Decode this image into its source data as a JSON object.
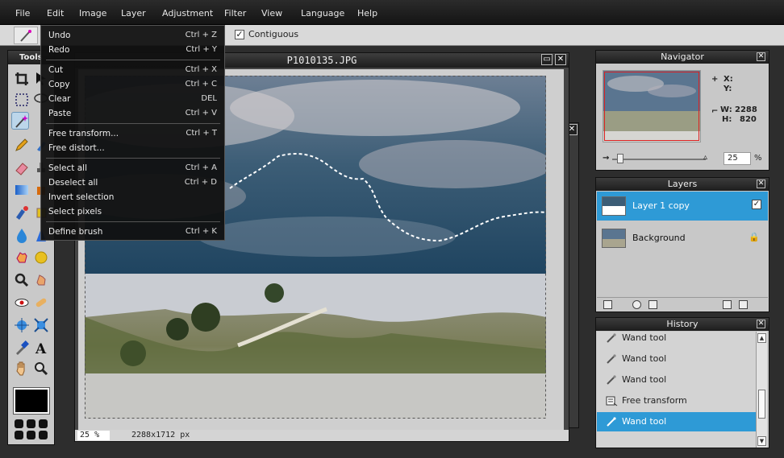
{
  "menubar": {
    "items": [
      "File",
      "Edit",
      "Image",
      "Layer",
      "Adjustment",
      "Filter",
      "View",
      "Language",
      "Help"
    ]
  },
  "options": {
    "contiguous_label": "Contiguous",
    "contiguous_checked": true
  },
  "tools_panel": {
    "title": "Tools"
  },
  "document": {
    "title": "P1010135.JPG",
    "zoom": "25",
    "zoom_unit": "%",
    "dimensions": "2288x1712 px"
  },
  "edit_menu": {
    "items": [
      {
        "label": "Undo",
        "shortcut": "Ctrl + Z"
      },
      {
        "label": "Redo",
        "shortcut": "Ctrl + Y"
      },
      {
        "label": "Cut",
        "shortcut": "Ctrl + X"
      },
      {
        "label": "Copy",
        "shortcut": "Ctrl + C"
      },
      {
        "label": "Clear",
        "shortcut": "DEL"
      },
      {
        "label": "Paste",
        "shortcut": "Ctrl + V"
      },
      {
        "label": "Free transform...",
        "shortcut": "Ctrl + T"
      },
      {
        "label": "Free distort...",
        "shortcut": ""
      },
      {
        "label": "Select all",
        "shortcut": "Ctrl + A"
      },
      {
        "label": "Deselect all",
        "shortcut": "Ctrl + D"
      },
      {
        "label": "Invert selection",
        "shortcut": ""
      },
      {
        "label": "Select pixels",
        "shortcut": ""
      },
      {
        "label": "Define brush",
        "shortcut": "Ctrl + K"
      }
    ]
  },
  "navigator": {
    "title": "Navigator",
    "x_label": "X:",
    "y_label": "Y:",
    "w_label": "W:",
    "w_value": "2288",
    "h_label": "H:",
    "h_value": "820",
    "zoom": "25",
    "zoom_unit": "%"
  },
  "layers": {
    "title": "Layers",
    "items": [
      {
        "name": "Layer 1 copy",
        "selected": true,
        "visible": true
      },
      {
        "name": "Background",
        "selected": false,
        "locked": true
      }
    ]
  },
  "history": {
    "title": "History",
    "items": [
      {
        "label": "Wand tool",
        "icon": "wand-icon"
      },
      {
        "label": "Wand tool",
        "icon": "wand-icon"
      },
      {
        "label": "Wand tool",
        "icon": "wand-icon"
      },
      {
        "label": "Free transform",
        "icon": "transform-icon"
      },
      {
        "label": "Wand tool",
        "icon": "wand-icon",
        "selected": true
      }
    ]
  },
  "colors": {
    "highlight": "#2e9ad6",
    "foreground": "#000000"
  }
}
